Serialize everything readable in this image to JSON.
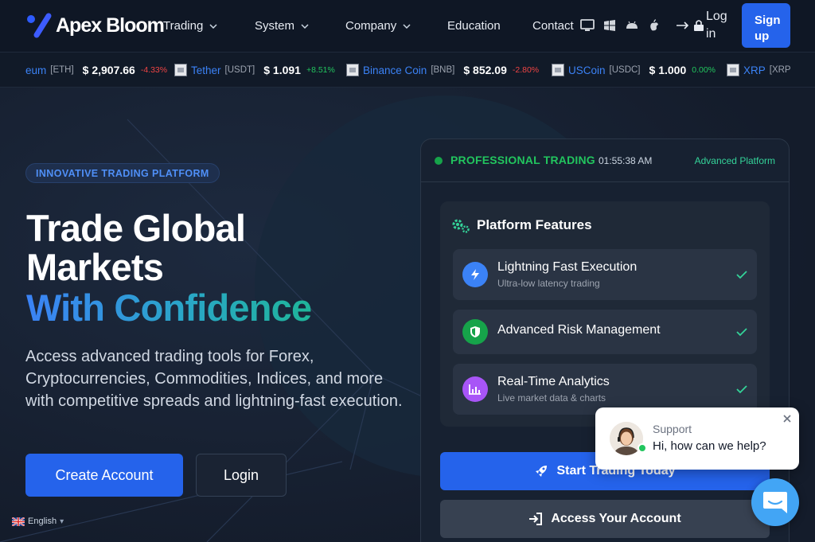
{
  "brand": {
    "name": "Apex Bloom"
  },
  "nav": {
    "items": [
      {
        "label": "Trading",
        "dropdown": true
      },
      {
        "label": "System",
        "dropdown": true
      },
      {
        "label": "Company",
        "dropdown": true
      },
      {
        "label": "Education",
        "dropdown": false
      },
      {
        "label": "Contact",
        "dropdown": false
      }
    ],
    "os_icons": [
      "desktop-icon",
      "windows-icon",
      "android-icon",
      "apple-icon"
    ],
    "login_label": "Log in",
    "signup_label": "Sign up"
  },
  "ticker": [
    {
      "name": "eum",
      "symbol": "[ETH]",
      "price": "$ 2,907.66",
      "change": "-4.33%",
      "direction": "down"
    },
    {
      "name": "Tether",
      "symbol": "[USDT]",
      "price": "$ 1.091",
      "change": "+8.51%",
      "direction": "up"
    },
    {
      "name": "Binance Coin",
      "symbol": "[BNB]",
      "price": "$ 852.09",
      "change": "-2.80%",
      "direction": "down"
    },
    {
      "name": "USCoin",
      "symbol": "[USDC]",
      "price": "$ 1.000",
      "change": "0.00%",
      "direction": "up"
    },
    {
      "name": "XRP",
      "symbol": "[XRP",
      "price": "",
      "change": "",
      "direction": "up"
    }
  ],
  "hero": {
    "badge": "INNOVATIVE TRADING PLATFORM",
    "title_line1": "Trade Global",
    "title_line2": "Markets",
    "title_line3": "With Confidence",
    "lead": "Access advanced trading tools for Forex, Cryptocurrencies, Commodities, Indices, and more with competitive spreads and lightning-fast execution.",
    "create_account": "Create Account",
    "login": "Login"
  },
  "language": {
    "selected": "English"
  },
  "panel": {
    "status": "PROFESSIONAL TRADING",
    "time": "01:55:38 AM",
    "platform_label": "Advanced Platform",
    "features_title": "Platform Features",
    "features": [
      {
        "title": "Lightning Fast Execution",
        "subtitle": "Ultra-low latency trading",
        "icon": "bolt-icon",
        "color": "#3b82f6"
      },
      {
        "title": "Advanced Risk Management",
        "subtitle": "",
        "icon": "shield-icon",
        "color": "#16a34a"
      },
      {
        "title": "Real-Time Analytics",
        "subtitle": "Live market data & charts",
        "icon": "chart-icon",
        "color": "#a855f7"
      }
    ],
    "start_trading": "Start Trading Today",
    "access_account": "Access Your Account"
  },
  "chat": {
    "name": "Support",
    "message": "Hi, how can we help?"
  },
  "colors": {
    "accent": "#2563eb",
    "background": "#141c2b",
    "positive": "#22c55e",
    "negative": "#ef4444"
  }
}
